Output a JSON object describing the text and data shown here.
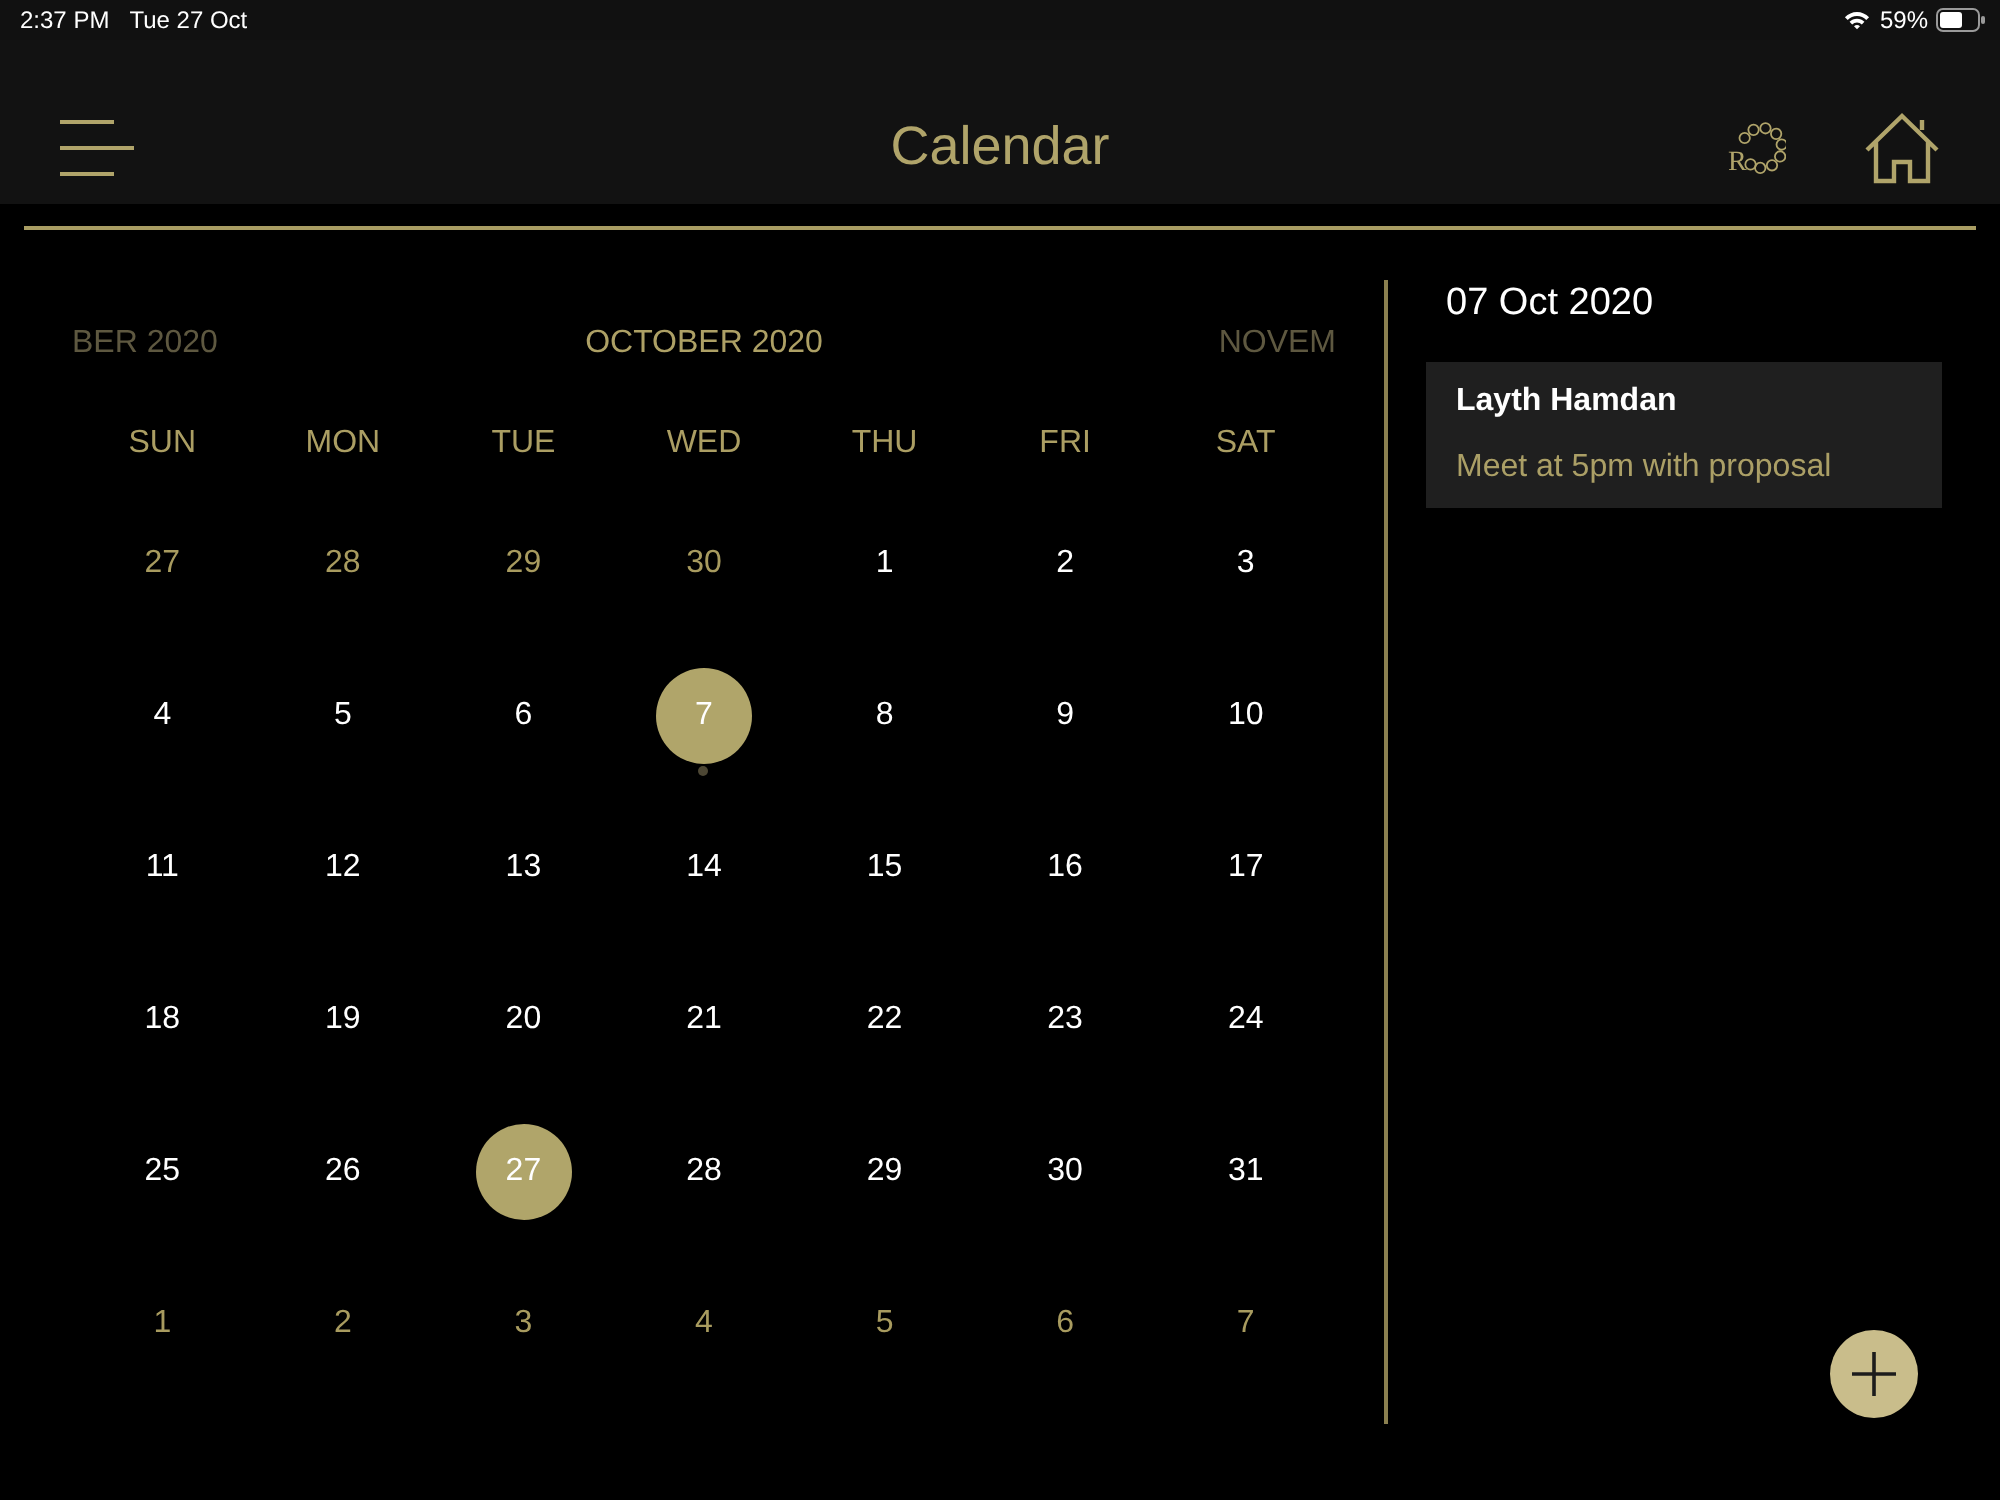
{
  "status_bar": {
    "time": "2:37 PM",
    "date": "Tue 27 Oct",
    "battery": "59%"
  },
  "header": {
    "title": "Calendar",
    "logo_letter": "R"
  },
  "calendar": {
    "months": [
      {
        "label": "BER 2020",
        "selected": false
      },
      {
        "label": "OCTOBER 2020",
        "selected": true
      },
      {
        "label": "NOVEM",
        "selected": false
      }
    ],
    "weekdays": [
      "SUN",
      "MON",
      "TUE",
      "WED",
      "THU",
      "FRI",
      "SAT"
    ],
    "weeks": [
      {
        "days": [
          {
            "day": "27",
            "outside": true,
            "selected": false,
            "today": false,
            "has_event": false
          },
          {
            "day": "28",
            "outside": true,
            "selected": false,
            "today": false,
            "has_event": false
          },
          {
            "day": "29",
            "outside": true,
            "selected": false,
            "today": false,
            "has_event": false
          },
          {
            "day": "30",
            "outside": true,
            "selected": false,
            "today": false,
            "has_event": false
          },
          {
            "day": "1",
            "outside": false,
            "selected": false,
            "today": false,
            "has_event": false
          },
          {
            "day": "2",
            "outside": false,
            "selected": false,
            "today": false,
            "has_event": false
          },
          {
            "day": "3",
            "outside": false,
            "selected": false,
            "today": false,
            "has_event": false
          }
        ]
      },
      {
        "days": [
          {
            "day": "4",
            "outside": false,
            "selected": false,
            "today": false,
            "has_event": false
          },
          {
            "day": "5",
            "outside": false,
            "selected": false,
            "today": false,
            "has_event": false
          },
          {
            "day": "6",
            "outside": false,
            "selected": false,
            "today": false,
            "has_event": false
          },
          {
            "day": "7",
            "outside": false,
            "selected": true,
            "today": false,
            "has_event": true
          },
          {
            "day": "8",
            "outside": false,
            "selected": false,
            "today": false,
            "has_event": false
          },
          {
            "day": "9",
            "outside": false,
            "selected": false,
            "today": false,
            "has_event": false
          },
          {
            "day": "10",
            "outside": false,
            "selected": false,
            "today": false,
            "has_event": false
          }
        ]
      },
      {
        "days": [
          {
            "day": "11",
            "outside": false,
            "selected": false,
            "today": false,
            "has_event": false
          },
          {
            "day": "12",
            "outside": false,
            "selected": false,
            "today": false,
            "has_event": false
          },
          {
            "day": "13",
            "outside": false,
            "selected": false,
            "today": false,
            "has_event": false
          },
          {
            "day": "14",
            "outside": false,
            "selected": false,
            "today": false,
            "has_event": false
          },
          {
            "day": "15",
            "outside": false,
            "selected": false,
            "today": false,
            "has_event": false
          },
          {
            "day": "16",
            "outside": false,
            "selected": false,
            "today": false,
            "has_event": false
          },
          {
            "day": "17",
            "outside": false,
            "selected": false,
            "today": false,
            "has_event": false
          }
        ]
      },
      {
        "days": [
          {
            "day": "18",
            "outside": false,
            "selected": false,
            "today": false,
            "has_event": false
          },
          {
            "day": "19",
            "outside": false,
            "selected": false,
            "today": false,
            "has_event": false
          },
          {
            "day": "20",
            "outside": false,
            "selected": false,
            "today": false,
            "has_event": false
          },
          {
            "day": "21",
            "outside": false,
            "selected": false,
            "today": false,
            "has_event": false
          },
          {
            "day": "22",
            "outside": false,
            "selected": false,
            "today": false,
            "has_event": false
          },
          {
            "day": "23",
            "outside": false,
            "selected": false,
            "today": false,
            "has_event": false
          },
          {
            "day": "24",
            "outside": false,
            "selected": false,
            "today": false,
            "has_event": false
          }
        ]
      },
      {
        "days": [
          {
            "day": "25",
            "outside": false,
            "selected": false,
            "today": false,
            "has_event": false
          },
          {
            "day": "26",
            "outside": false,
            "selected": false,
            "today": false,
            "has_event": false
          },
          {
            "day": "27",
            "outside": false,
            "selected": false,
            "today": true,
            "has_event": false
          },
          {
            "day": "28",
            "outside": false,
            "selected": false,
            "today": false,
            "has_event": false
          },
          {
            "day": "29",
            "outside": false,
            "selected": false,
            "today": false,
            "has_event": false
          },
          {
            "day": "30",
            "outside": false,
            "selected": false,
            "today": false,
            "has_event": false
          },
          {
            "day": "31",
            "outside": false,
            "selected": false,
            "today": false,
            "has_event": false
          }
        ]
      },
      {
        "days": [
          {
            "day": "1",
            "outside": true,
            "selected": false,
            "today": false,
            "has_event": false
          },
          {
            "day": "2",
            "outside": true,
            "selected": false,
            "today": false,
            "has_event": false
          },
          {
            "day": "3",
            "outside": true,
            "selected": false,
            "today": false,
            "has_event": false
          },
          {
            "day": "4",
            "outside": true,
            "selected": false,
            "today": false,
            "has_event": false
          },
          {
            "day": "5",
            "outside": true,
            "selected": false,
            "today": false,
            "has_event": false
          },
          {
            "day": "6",
            "outside": true,
            "selected": false,
            "today": false,
            "has_event": false
          },
          {
            "day": "7",
            "outside": true,
            "selected": false,
            "today": false,
            "has_event": false
          }
        ]
      }
    ]
  },
  "agenda": {
    "date": "07 Oct 2020",
    "events": [
      {
        "title": "Layth Hamdan",
        "note": "Meet at 5pm with proposal"
      }
    ]
  }
}
